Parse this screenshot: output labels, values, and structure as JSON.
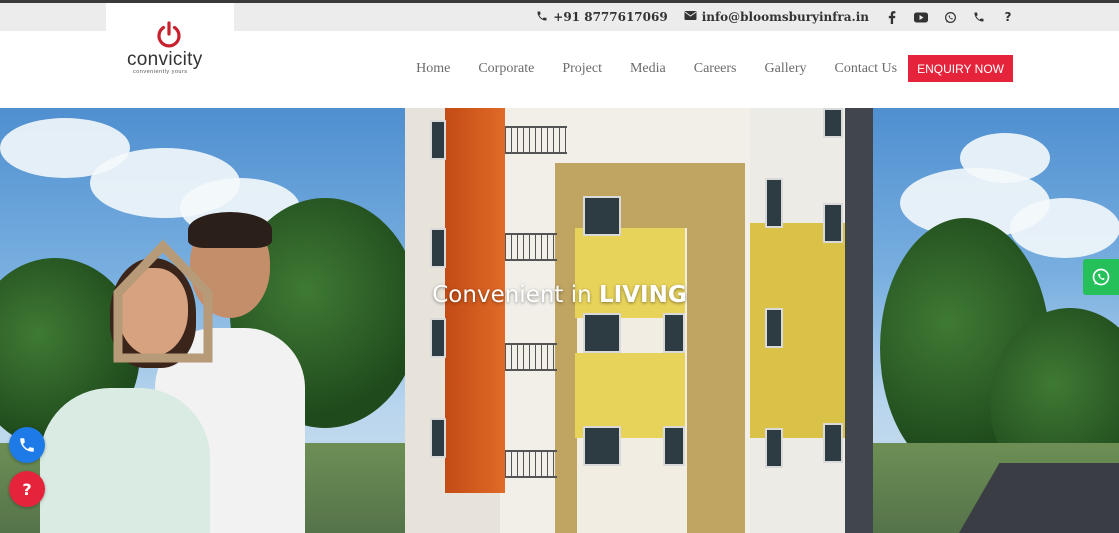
{
  "topbar": {
    "phone": "+91 8777617069",
    "email": "info@bloomsburyinfra.in",
    "social": [
      "facebook-icon",
      "youtube-icon",
      "whatsapp-icon",
      "phone-icon",
      "question-icon"
    ]
  },
  "logo": {
    "name": "convicity",
    "tagline": "conveniently yours"
  },
  "nav": {
    "items": [
      "Home",
      "Corporate",
      "Project",
      "Media",
      "Careers",
      "Gallery",
      "Contact Us"
    ],
    "cta": "ENQUIRY NOW"
  },
  "hero": {
    "title_prefix": "Convenient in ",
    "title_bold": "LIVING"
  },
  "colors": {
    "accent": "#e5243b",
    "whatsapp": "#25c05a",
    "call": "#1e7ae6"
  }
}
